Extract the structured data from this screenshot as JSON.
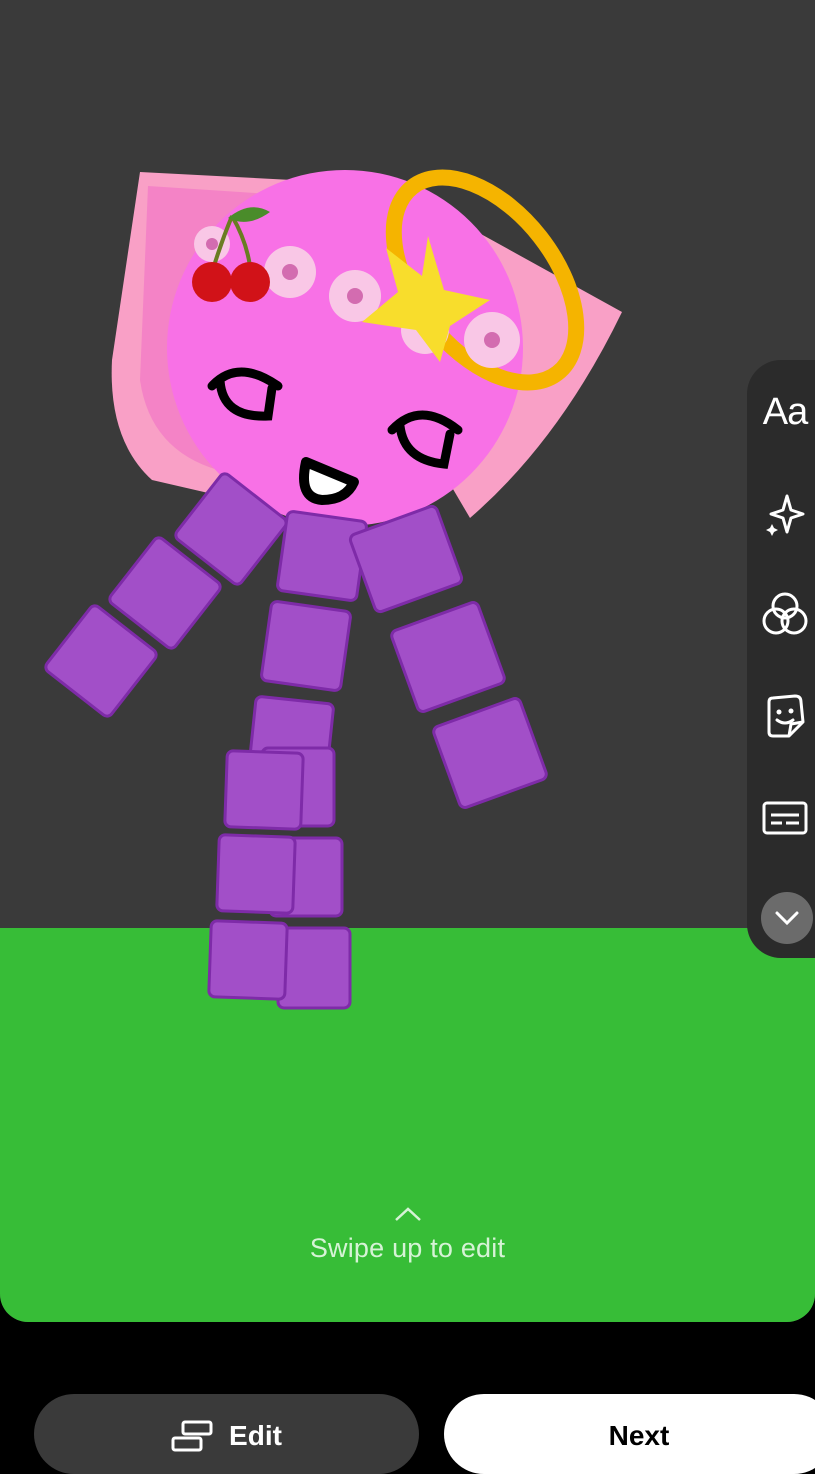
{
  "canvas": {
    "background_color": "#3a3a3a",
    "ground_color": "#37bd37",
    "swipe_hint": "Swipe up to edit"
  },
  "toolbar": {
    "text_tool_label": "Aa",
    "items": [
      "text-icon",
      "sparkle-icon",
      "filter-icon",
      "sticker-icon",
      "captions-icon",
      "chevron-down-icon"
    ]
  },
  "bottom_bar": {
    "edit_label": "Edit",
    "next_label": "Next"
  }
}
